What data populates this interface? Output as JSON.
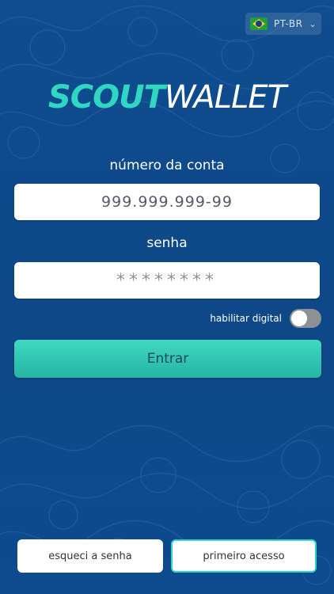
{
  "language": {
    "code": "PT-BR",
    "flag_icon": "brazil-flag-icon"
  },
  "logo": {
    "part1": "SCOUT",
    "part2": "WALLET"
  },
  "account": {
    "label": "número da conta",
    "value": "999.999.999-99"
  },
  "password": {
    "label": "senha",
    "value": "********"
  },
  "fingerprint": {
    "label": "habilitar digital",
    "enabled": false
  },
  "login_button": "Entrar",
  "forgot_button": "esqueci a senha",
  "first_access_button": "primeiro acesso",
  "colors": {
    "background": "#0f4a8c",
    "accent": "#2fd6c2",
    "button": "#34c7b2"
  }
}
